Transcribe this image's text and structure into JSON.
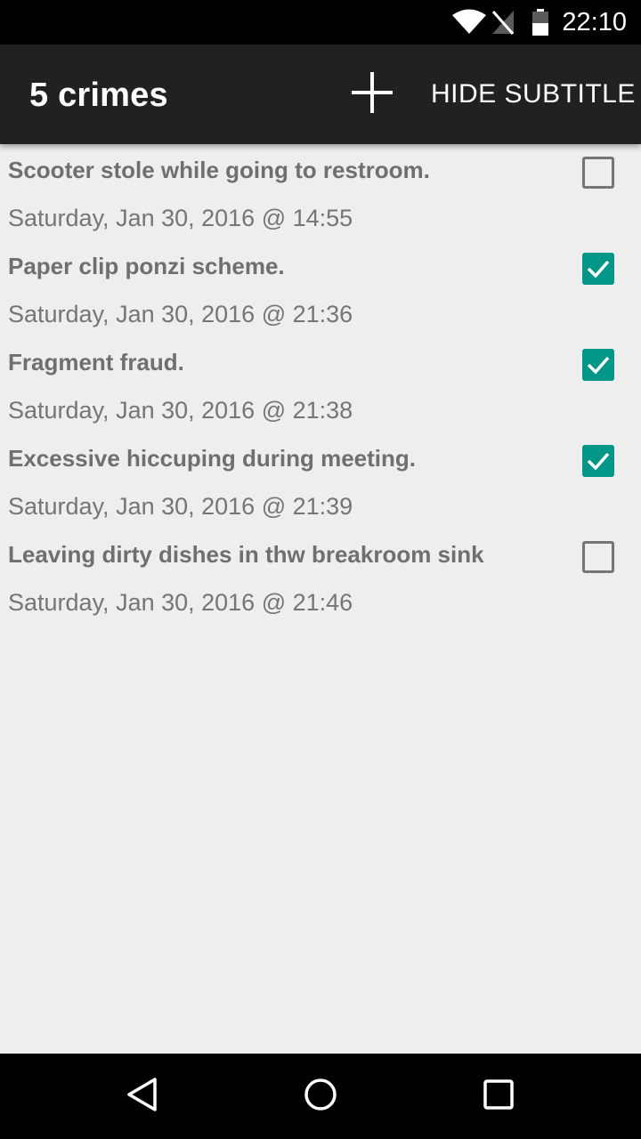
{
  "status_bar": {
    "time": "22:10",
    "icons": [
      "wifi-icon",
      "no-signal-icon",
      "battery-icon"
    ]
  },
  "app_bar": {
    "title": "5 crimes",
    "add_icon": "plus-icon",
    "action_label": "HIDE SUBTITLE"
  },
  "crimes": [
    {
      "title": "Scooter stole while going to restroom.",
      "date": "Saturday, Jan 30, 2016 @ 14:55",
      "solved": false
    },
    {
      "title": "Paper clip ponzi scheme.",
      "date": "Saturday, Jan 30, 2016 @ 21:36",
      "solved": true
    },
    {
      "title": "Fragment fraud.",
      "date": "Saturday, Jan 30, 2016 @ 21:38",
      "solved": true
    },
    {
      "title": "Excessive hiccuping during meeting.",
      "date": "Saturday, Jan 30, 2016 @ 21:39",
      "solved": true
    },
    {
      "title": "Leaving dirty dishes in thw breakroom sink",
      "date": "Saturday, Jan 30, 2016 @ 21:46",
      "solved": false
    }
  ],
  "nav_bar": {
    "icons": [
      "back-icon",
      "home-icon",
      "recents-icon"
    ]
  },
  "colors": {
    "accent": "#009688",
    "app_bar": "#212121",
    "background": "#eeeeee"
  }
}
